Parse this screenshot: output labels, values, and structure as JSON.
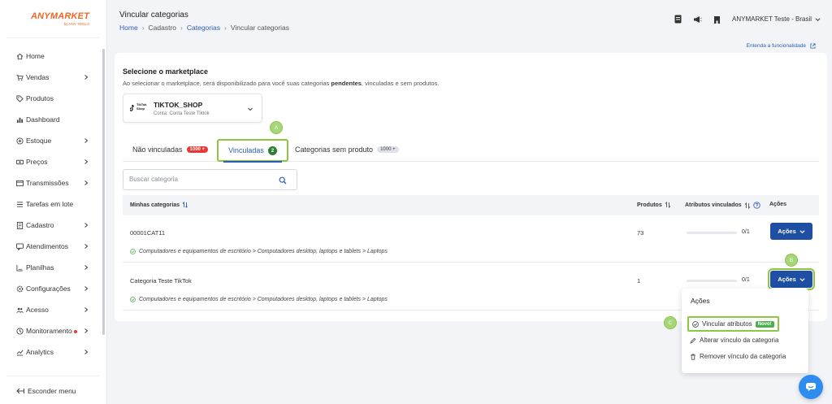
{
  "colors": {
    "brand": "#f26522",
    "primary": "#1e4fa3",
    "link": "#2b5fb3",
    "highlight": "#8dc63f",
    "danger": "#e53935"
  },
  "logo": {
    "brand": "ANYMARKET",
    "sub": "by ANY TOOLS"
  },
  "sidebar": {
    "items": [
      {
        "label": "Home",
        "icon": "home-icon"
      },
      {
        "label": "Vendas",
        "icon": "cart-icon"
      },
      {
        "label": "Produtos",
        "icon": "tag-icon"
      },
      {
        "label": "Dashboard",
        "icon": "bar-chart-icon"
      },
      {
        "label": "Estoque",
        "icon": "box-icon"
      },
      {
        "label": "Preços",
        "icon": "money-icon"
      },
      {
        "label": "Transmissões",
        "icon": "window-icon"
      },
      {
        "label": "Tarefas em lote",
        "icon": "list-icon"
      },
      {
        "label": "Cadastro",
        "icon": "register-icon"
      },
      {
        "label": "Atendimentos",
        "icon": "chat-icon"
      },
      {
        "label": "Planilhas",
        "icon": "spreadsheet-icon"
      },
      {
        "label": "Configurações",
        "icon": "gear-icon"
      },
      {
        "label": "Acesso",
        "icon": "users-icon"
      },
      {
        "label": "Monitoramento",
        "icon": "monitor-icon"
      },
      {
        "label": "Analytics",
        "icon": "analytics-icon"
      }
    ],
    "hide_menu": "Esconder menu"
  },
  "header": {
    "title": "Vincular categorias",
    "breadcrumb": [
      "Home",
      "Cadastro",
      "Categorias",
      "Vincular categorias"
    ],
    "account": "ANYMARKET Teste - Brasil",
    "help_link": "Entenda a funcionalidade"
  },
  "marketplace": {
    "title": "Selecione o marketplace",
    "desc_prefix": "Ao selecionar o marketplace, será disponibilizado para você suas categorias ",
    "desc_bold": "pendentes",
    "desc_suffix": ", vinculadas e sem produtos.",
    "name": "TIKTOK_SHOP",
    "account": "Conta: Conta Teste Tiktok",
    "logo_text": "TikTok Shop"
  },
  "tabs": [
    {
      "label": "Não vinculadas",
      "count": "1000 +"
    },
    {
      "label": "Vinculadas",
      "count": "2"
    },
    {
      "label": "Categorias sem produto",
      "count": "1000 +"
    }
  ],
  "markers": {
    "a": "A",
    "b": "B",
    "c": "C"
  },
  "search": {
    "placeholder": "Buscar categoria"
  },
  "table": {
    "headers": [
      "Minhas categorias",
      "Produtos",
      "Atributos vinculados",
      "Ações"
    ],
    "rows": [
      {
        "code": "00001CAT11",
        "path": "Computadores e equipamentos de escritório > Computadores desktop, laptops e tablets > Laptops",
        "products": "73",
        "progress_text": "0/1",
        "progress": 0,
        "action": "Ações"
      },
      {
        "code": "Categoria Teste TikTok",
        "path": "Computadores e equipamentos de escritório > Computadores desktop, laptops e tablets > Laptops",
        "products": "1",
        "progress_text": "0/1",
        "progress": 0,
        "action": "Ações"
      }
    ]
  },
  "dropdown": {
    "title": "Ações",
    "items": [
      "Vincular atributos",
      "Alterar vínculo da categoria",
      "Remover vínculo da categoria"
    ],
    "new_badge": "Novo!"
  }
}
